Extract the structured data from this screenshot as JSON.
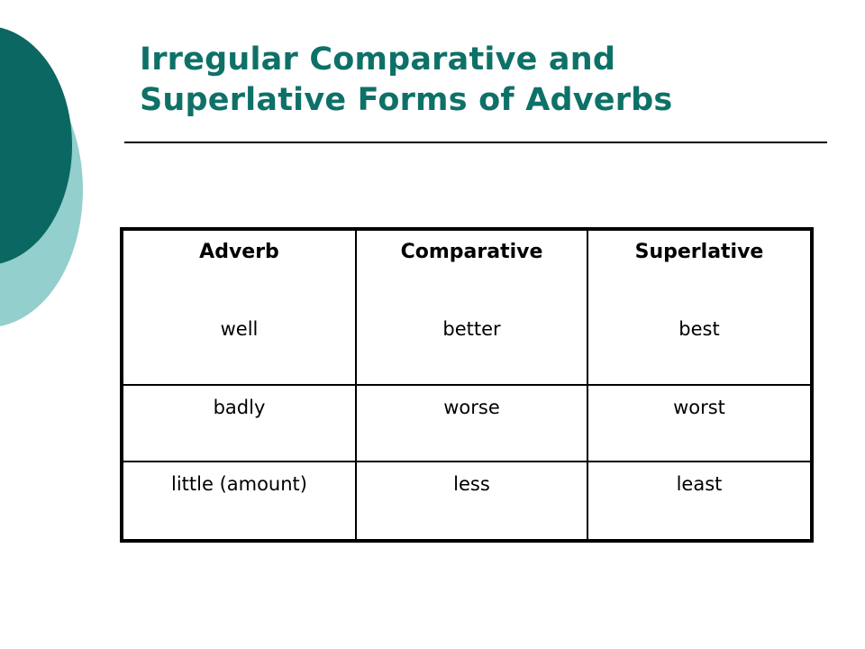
{
  "slide": {
    "background_color": "#FFFFFF",
    "accent_dark_teal": "#0B6762",
    "accent_light_teal": "#93CFCC",
    "title_color": "#0E7168",
    "rule_color": "#000000",
    "table_border_color": "#000000",
    "text_color": "#000000"
  },
  "title": {
    "line1": "Irregular Comparative and",
    "line2": "Superlative Forms of Adverbs",
    "full": "Irregular Comparative and Superlative Forms of Adverbs"
  },
  "table": {
    "headers": [
      "Adverb",
      "Comparative",
      "Superlative"
    ],
    "rows": [
      [
        "well",
        "better",
        "best"
      ],
      [
        "badly",
        "worse",
        "worst"
      ],
      [
        "little (amount)",
        "less",
        "least"
      ]
    ]
  },
  "decorations": {
    "dark_circle": "dark-teal-circle",
    "light_circle": "light-teal-circle"
  }
}
